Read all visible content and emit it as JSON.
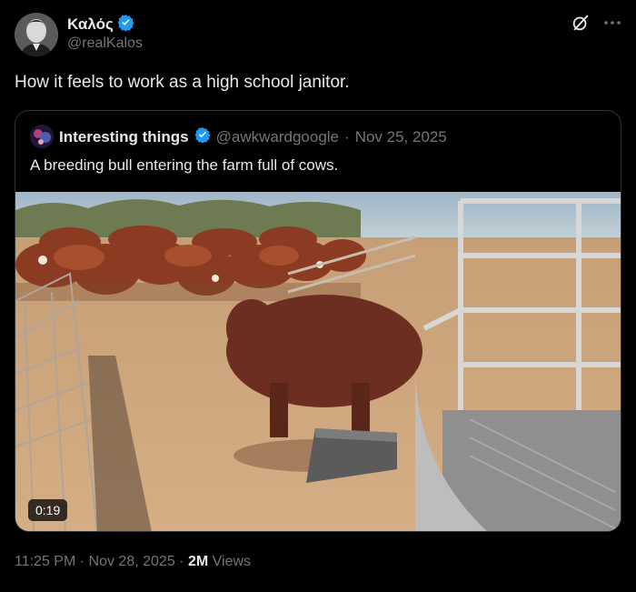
{
  "author": {
    "name": "Καλός",
    "handle": "@realKalos",
    "verified": true
  },
  "tweet": {
    "text": "How it feels to work as a high school janitor."
  },
  "quoted": {
    "name": "Interesting things",
    "handle": "@awkwardgoogle",
    "separator": "·",
    "date": "Nov 25, 2025",
    "text": "A breeding bull entering the farm full of cows.",
    "media": {
      "duration": "0:19",
      "description_icon": "video-thumbnail"
    }
  },
  "footer": {
    "time": "11:25 PM",
    "separator": "·",
    "date": "Nov 28, 2025",
    "separator2": "·",
    "views_count": "2M",
    "views_label": "Views"
  },
  "icons": {
    "verified": "verified-badge-icon",
    "grok": "grok-icon",
    "more": "more-icon"
  },
  "colors": {
    "background": "#000000",
    "text_primary": "#e7e9ea",
    "text_secondary": "#71767b",
    "border": "#2f3336",
    "verified_blue": "#1d9bf0"
  }
}
